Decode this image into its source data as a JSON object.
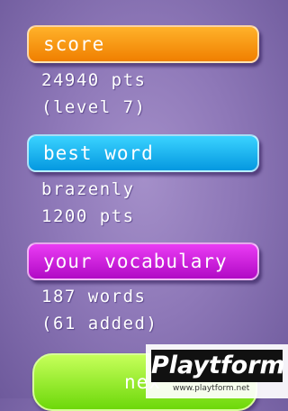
{
  "score": {
    "label": "score",
    "points": "24940 pts",
    "level": "(level 7)"
  },
  "best_word": {
    "label": "best word",
    "word": "brazenly",
    "points": "1200 pts"
  },
  "vocabulary": {
    "label": "your vocabulary",
    "words": "187 words",
    "added": "(61 added)"
  },
  "next_button": {
    "label": "nex"
  },
  "watermark": {
    "logo": "Playtform",
    "url": "www.playtform.net"
  },
  "colors": {
    "score": "#f59400",
    "best_word": "#1bb6f2",
    "vocabulary": "#d020e0",
    "next": "#8ee81c",
    "background": "#8e78b8"
  }
}
